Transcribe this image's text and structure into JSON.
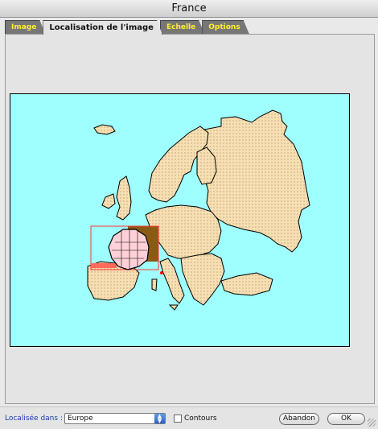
{
  "window": {
    "title": "France"
  },
  "tabs": [
    {
      "label": "Image",
      "active": false
    },
    {
      "label": "Localisation de l'image",
      "active": true
    },
    {
      "label": "Echelle",
      "active": false
    },
    {
      "label": "Options",
      "active": false
    }
  ],
  "map": {
    "region": "Europe",
    "highlighted_country": "France",
    "colors": {
      "sea": "#9fffff",
      "land": "#f8dfb2",
      "border": "#000000",
      "highlight_frame": "#ff3333",
      "highlight_fill": "#8b5a14",
      "country_fill": "#ffd0d8"
    }
  },
  "footer": {
    "location_label": "Localisée dans :",
    "location_value": "Europe",
    "contours_label": "Contours",
    "contours_checked": false,
    "cancel_label": "Abandon",
    "ok_label": "OK"
  },
  "icons": {
    "select_arrows": "up-down-arrows-icon",
    "resize": "resize-grip-icon"
  }
}
